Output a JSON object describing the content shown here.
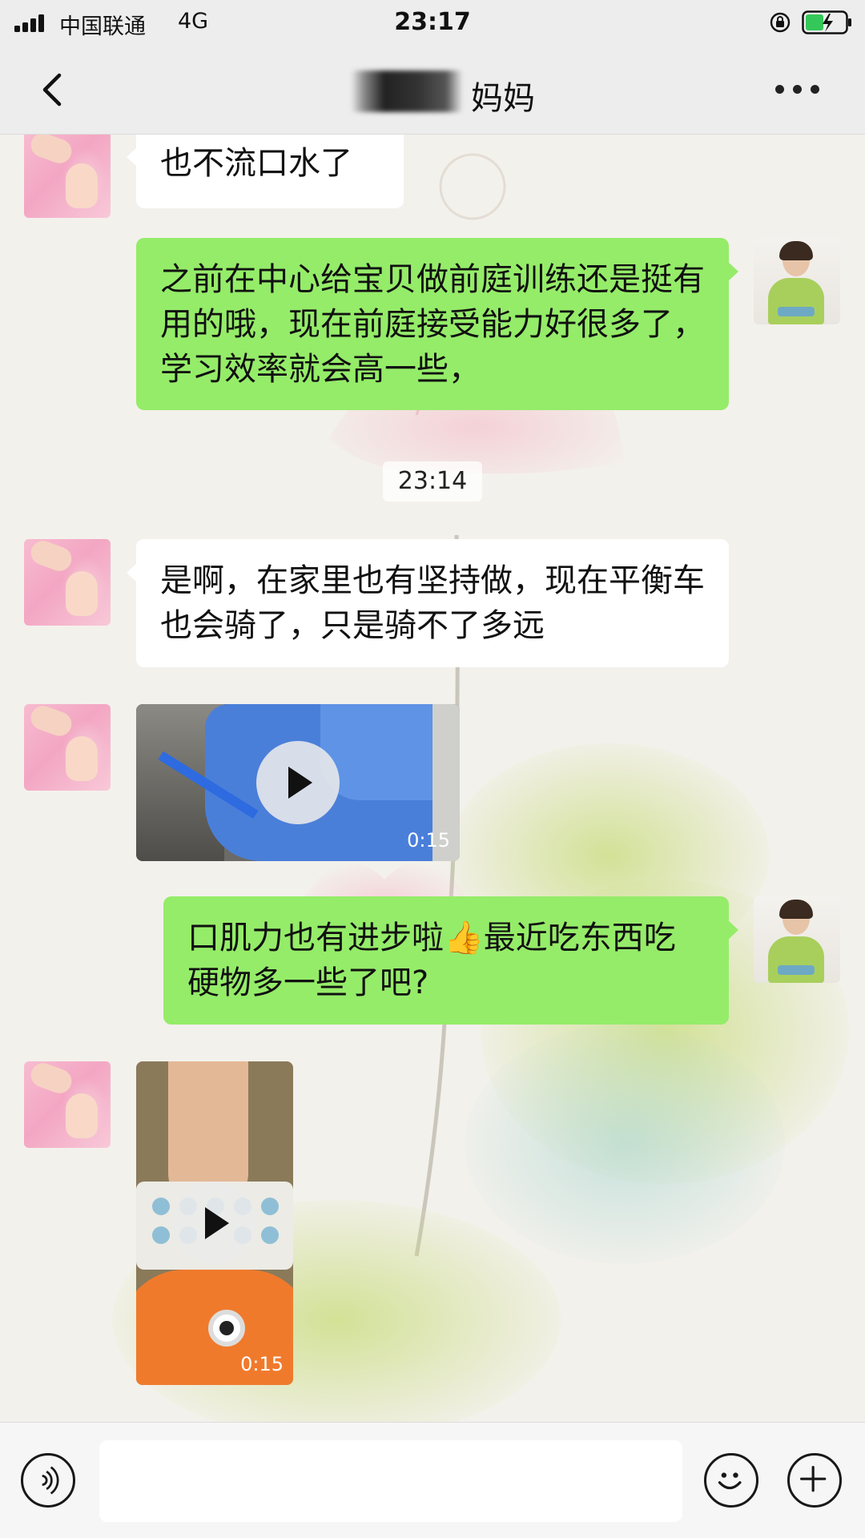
{
  "status_bar": {
    "carrier": "中国联通",
    "network": "4G",
    "time": "23:17"
  },
  "nav": {
    "title": "妈妈",
    "back_icon": "chevron-left-icon",
    "more_icon": "more-dots-icon"
  },
  "messages": [
    {
      "type": "text",
      "side": "in",
      "text": "也不流口水了"
    },
    {
      "type": "text",
      "side": "out",
      "text": "之前在中心给宝贝做前庭训练还是挺有用的哦，现在前庭接受能力好很多了，学习效率就会高一些，"
    },
    {
      "type": "time",
      "text": "23:14"
    },
    {
      "type": "text",
      "side": "in",
      "text": "是啊，在家里也有坚持做，现在平衡车也会骑了，只是骑不了多远"
    },
    {
      "type": "video",
      "side": "in",
      "duration": "0:15"
    },
    {
      "type": "text",
      "side": "out",
      "text": "口肌力也有进步啦👍最近吃东西吃硬物多一些了吧?"
    },
    {
      "type": "video",
      "side": "in",
      "duration": "0:15"
    }
  ],
  "input_bar": {
    "placeholder": "",
    "voice_icon": "voice-icon",
    "emoji_icon": "emoji-icon",
    "plus_icon": "plus-icon"
  },
  "colors": {
    "out_bubble": "#95ec69",
    "in_bubble": "#ffffff",
    "bar_bg": "#ededed"
  }
}
